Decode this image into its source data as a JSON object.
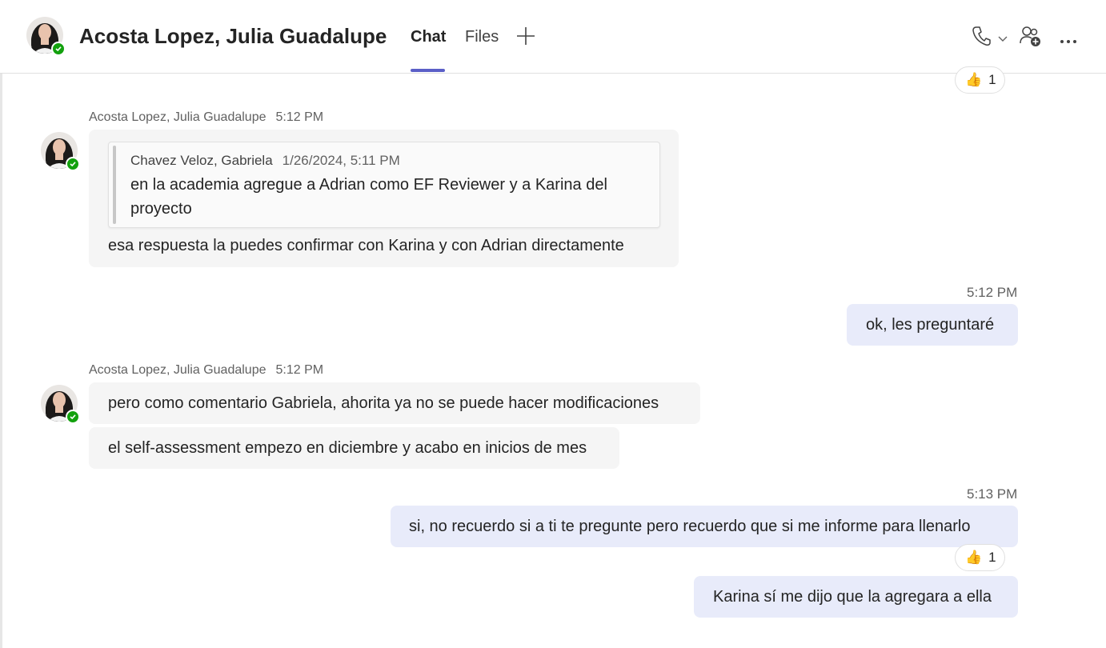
{
  "header": {
    "contact_name": "Acosta Lopez, Julia Guadalupe",
    "tabs": [
      {
        "label": "Chat",
        "active": true
      },
      {
        "label": "Files",
        "active": false
      }
    ],
    "icons": [
      "add-tab-icon",
      "call-icon",
      "chevron-down-icon",
      "add-people-icon",
      "more-options-icon"
    ]
  },
  "messages": {
    "top_reaction": {
      "emoji": "👍",
      "count": "1"
    },
    "m1": {
      "sender": "Acosta Lopez, Julia Guadalupe",
      "time": "5:12 PM",
      "quote": {
        "author": "Chavez Veloz, Gabriela",
        "date": "1/26/2024, 5:11 PM",
        "text": "en la academia agregue a Adrian como EF Reviewer y a Karina del proyecto"
      },
      "text": "esa respuesta la puedes confirmar con Karina y con Adrian directamente"
    },
    "m2": {
      "time": "5:12 PM",
      "text": "ok, les preguntaré"
    },
    "m3": {
      "sender": "Acosta Lopez, Julia Guadalupe",
      "time": "5:12 PM",
      "lines": [
        "pero como comentario Gabriela, ahorita ya no se puede hacer modificaciones",
        "el self-assessment empezo en diciembre y acabo en inicios de mes"
      ]
    },
    "m4": {
      "time": "5:13 PM",
      "lines": [
        "si, no recuerdo si a ti te pregunte pero recuerdo que si me informe para llenarlo",
        "Karina sí me dijo que la agregara a ella"
      ],
      "reaction": {
        "emoji": "👍",
        "count": "1"
      }
    }
  },
  "colors": {
    "accent": "#5b5fc7",
    "self_bubble": "#e8ebfa",
    "other_bubble": "#f5f5f5",
    "presence_available": "#13a10e"
  }
}
